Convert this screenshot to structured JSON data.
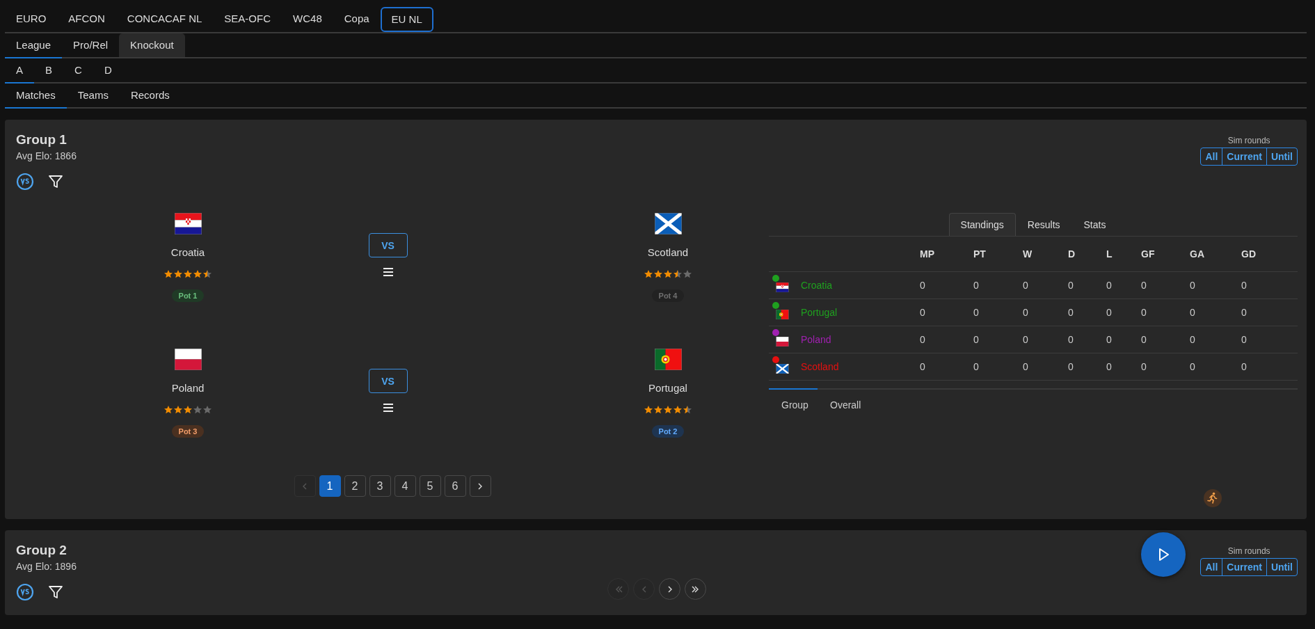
{
  "league_tabs": [
    {
      "label": "EURO",
      "selected": false
    },
    {
      "label": "AFCON",
      "selected": false
    },
    {
      "label": "CONCACAF NL",
      "selected": false
    },
    {
      "label": "SEA-OFC",
      "selected": false
    },
    {
      "label": "WC48",
      "selected": false
    },
    {
      "label": "Copa",
      "selected": false
    },
    {
      "label": "EU NL",
      "selected": true
    }
  ],
  "mode_tabs": [
    {
      "label": "League",
      "selected": true,
      "hovered": false
    },
    {
      "label": "Pro/Rel",
      "selected": false,
      "hovered": false
    },
    {
      "label": "Knockout",
      "selected": false,
      "hovered": true
    }
  ],
  "division_tabs": [
    {
      "label": "A",
      "selected": true
    },
    {
      "label": "B",
      "selected": false
    },
    {
      "label": "C",
      "selected": false
    },
    {
      "label": "D",
      "selected": false
    }
  ],
  "view_tabs": [
    {
      "label": "Matches",
      "selected": true
    },
    {
      "label": "Teams",
      "selected": false
    },
    {
      "label": "Records",
      "selected": false
    }
  ],
  "groups": [
    {
      "title": "Group 1",
      "avg_elo": "Avg Elo: 1866",
      "sim": {
        "label": "Sim rounds",
        "buttons": [
          "All",
          "Current",
          "Until"
        ]
      },
      "matches": [
        {
          "vs": "VS",
          "home": {
            "name": "Croatia",
            "kind": "croatia",
            "stars": 4.5,
            "pot": {
              "label": "Pot 1",
              "color": "#203a26"
            }
          },
          "away": {
            "name": "Scotland",
            "kind": "scotland",
            "stars": 3.5,
            "pot": {
              "label": "Pot 4",
              "color": "#222222"
            }
          }
        },
        {
          "vs": "VS",
          "home": {
            "name": "Poland",
            "kind": "poland",
            "stars": 3,
            "pot": {
              "label": "Pot 3",
              "color": "#4a3020"
            }
          },
          "away": {
            "name": "Portugal",
            "kind": "portugal",
            "stars": 4.5,
            "pot": {
              "label": "Pot 2",
              "color": "#1e3450"
            }
          }
        }
      ],
      "pagination": [
        {
          "kind": "prev",
          "disabled": true
        },
        {
          "kind": "page",
          "label": "1",
          "selected": true
        },
        {
          "kind": "page",
          "label": "2",
          "selected": false
        },
        {
          "kind": "page",
          "label": "3",
          "selected": false
        },
        {
          "kind": "page",
          "label": "4",
          "selected": false
        },
        {
          "kind": "page",
          "label": "5",
          "selected": false
        },
        {
          "kind": "page",
          "label": "6",
          "selected": false
        },
        {
          "kind": "next",
          "disabled": false
        }
      ],
      "standings": {
        "tabs": [
          {
            "label": "Standings",
            "selected": true
          },
          {
            "label": "Results",
            "selected": false
          },
          {
            "label": "Stats",
            "selected": false
          }
        ],
        "columns": [
          "MP",
          "PT",
          "W",
          "D",
          "L",
          "GF",
          "GA",
          "GD"
        ],
        "rows": [
          {
            "team": "Croatia",
            "kind": "croatia",
            "color": "#1fa01f",
            "values": [
              "0",
              "0",
              "0",
              "0",
              "0",
              "0",
              "0",
              "0"
            ]
          },
          {
            "team": "Portugal",
            "kind": "portugal",
            "color": "#1fa01f",
            "values": [
              "0",
              "0",
              "0",
              "0",
              "0",
              "0",
              "0",
              "0"
            ]
          },
          {
            "team": "Poland",
            "kind": "poland",
            "color": "#a020b0",
            "values": [
              "0",
              "0",
              "0",
              "0",
              "0",
              "0",
              "0",
              "0"
            ]
          },
          {
            "team": "Scotland",
            "kind": "scotland",
            "color": "#e51010",
            "values": [
              "0",
              "0",
              "0",
              "0",
              "0",
              "0",
              "0",
              "0"
            ]
          }
        ],
        "scope_tabs": [
          {
            "label": "Group",
            "selected": true
          },
          {
            "label": "Overall",
            "selected": false
          }
        ]
      }
    },
    {
      "title": "Group 2",
      "avg_elo": "Avg Elo: 1896",
      "sim": {
        "label": "Sim rounds",
        "buttons": [
          "All",
          "Current",
          "Until"
        ]
      },
      "round_nav": [
        {
          "kind": "first",
          "disabled": true
        },
        {
          "kind": "prev",
          "disabled": true
        },
        {
          "kind": "next",
          "disabled": false
        },
        {
          "kind": "last",
          "disabled": false
        }
      ]
    }
  ]
}
